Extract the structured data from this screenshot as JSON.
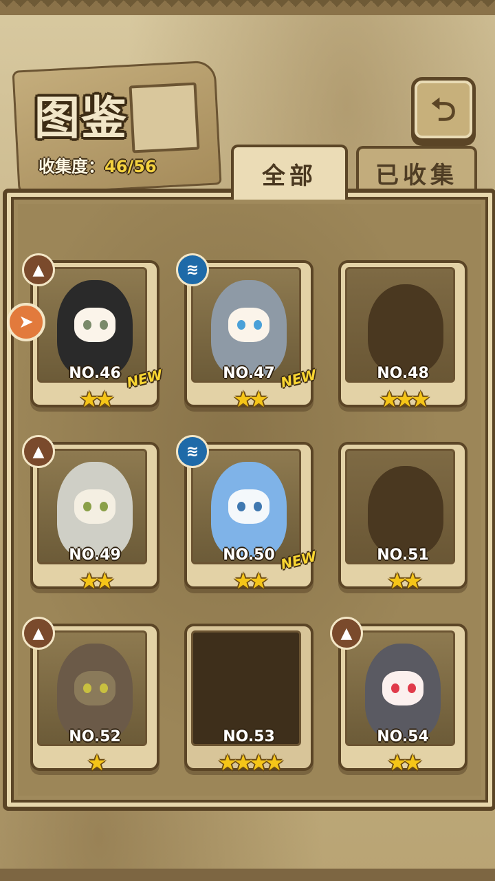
{
  "header": {
    "title": "图鉴",
    "collection_label": "收集度：",
    "collection_value": "46/56",
    "back_icon": "return-arrow-icon"
  },
  "tabs": [
    {
      "label": "全部",
      "selected": true
    },
    {
      "label": "已收集",
      "selected": false
    }
  ],
  "cards": [
    {
      "number": "NO.46",
      "stars": "★★",
      "star_count": 2,
      "new": "NEW",
      "badge": "earth-type-icon",
      "state": "collected",
      "hair": "#2a2a2a",
      "skin": "#fbf4ea",
      "eyes": "#7a8a6a"
    },
    {
      "number": "NO.47",
      "stars": "★★",
      "star_count": 2,
      "new": "NEW",
      "badge": "water-type-icon",
      "state": "collected",
      "hair": "#8e9aa6",
      "skin": "#fbf4ea",
      "eyes": "#4aa0d8"
    },
    {
      "number": "NO.48",
      "stars": "★★★",
      "star_count": 3,
      "new": "",
      "badge": "",
      "state": "locked"
    },
    {
      "number": "NO.49",
      "stars": "★★",
      "star_count": 2,
      "new": "",
      "badge": "earth-type-icon",
      "state": "collected",
      "hair": "#cfcfc6",
      "skin": "#f4efe2",
      "eyes": "#8aa048"
    },
    {
      "number": "NO.50",
      "stars": "★★",
      "star_count": 2,
      "new": "NEW",
      "badge": "water-type-icon",
      "state": "collected",
      "hair": "#7fb3e8",
      "skin": "#f4f8fb",
      "eyes": "#3f78b0"
    },
    {
      "number": "NO.51",
      "stars": "★★",
      "star_count": 2,
      "new": "",
      "badge": "",
      "state": "locked"
    },
    {
      "number": "NO.52",
      "stars": "★",
      "star_count": 1,
      "new": "",
      "badge": "earth-type-icon",
      "state": "collected",
      "hair": "#6b5a48",
      "skin": "#8a7a5a",
      "eyes": "#c8c040"
    },
    {
      "number": "NO.53",
      "stars": "★★★★",
      "star_count": 4,
      "new": "",
      "badge": "",
      "state": "empty"
    },
    {
      "number": "NO.54",
      "stars": "★★",
      "star_count": 2,
      "new": "",
      "badge": "earth-type-icon",
      "state": "collected",
      "hair": "#5a5a62",
      "skin": "#fbf0ee",
      "eyes": "#e03a4a"
    }
  ],
  "colors": {
    "panel_border": "#5b4526",
    "star": "#f5c518",
    "new_tag": "#f8d531",
    "earth_badge": "#7a4a2c",
    "water_badge": "#1e6aa8",
    "side_arrow": "#e27a3c"
  },
  "side_arrow_icon": "navigate-arrow-icon"
}
